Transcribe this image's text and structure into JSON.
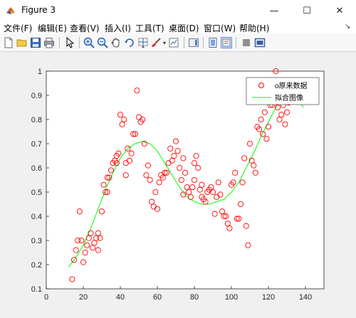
{
  "window": {
    "title": "Figure 3",
    "min_symbol": "—",
    "max_symbol": "☐",
    "close_symbol": "✕"
  },
  "menu": [
    {
      "label": "文件(F)",
      "name": "menu-file"
    },
    {
      "label": "编辑(E)",
      "name": "menu-edit"
    },
    {
      "label": "查看(V)",
      "name": "menu-view"
    },
    {
      "label": "插入(I)",
      "name": "menu-insert"
    },
    {
      "label": "工具(T)",
      "name": "menu-tools"
    },
    {
      "label": "桌面(D)",
      "name": "menu-desktop"
    },
    {
      "label": "窗口(W)",
      "name": "menu-window"
    },
    {
      "label": "帮助(H)",
      "name": "menu-help"
    }
  ],
  "toolbar": [
    "new-figure-icon",
    "open-file-icon",
    "save-icon",
    "print-icon",
    "pointer-icon",
    "zoom-in-icon",
    "zoom-out-icon",
    "pan-icon",
    "rotate-3d-icon",
    "data-cursor-icon",
    "brush-icon",
    "link-plot-icon",
    "insert-colorbar-icon",
    "insert-legend-icon",
    "hide-plot-tools-icon",
    "show-plot-tools-icon"
  ],
  "chart_data": {
    "type": "scatter",
    "xlim": [
      0,
      150
    ],
    "ylim": [
      0.1,
      1.0
    ],
    "xticks": [
      0,
      20,
      40,
      60,
      80,
      100,
      120,
      140
    ],
    "yticks": [
      0.1,
      0.2,
      0.3,
      0.4,
      0.5,
      0.6,
      0.7,
      0.8,
      0.9,
      1
    ],
    "xtick_labels": [
      "0",
      "20",
      "40",
      "60",
      "80",
      "100",
      "120",
      "140"
    ],
    "ytick_labels": [
      "0.1",
      "0.2",
      "0.3",
      "0.4",
      "0.5",
      "0.6",
      "0.7",
      "0.8",
      "0.9",
      "1"
    ],
    "grid": false,
    "legend_position": "top-right",
    "colors": {
      "scatter": "#ff0000",
      "fit": "#00ff00"
    },
    "series": [
      {
        "name": "o原来数据",
        "style": "circle",
        "points": [
          [
            14,
            0.14
          ],
          [
            15,
            0.22
          ],
          [
            16,
            0.26
          ],
          [
            17,
            0.3
          ],
          [
            18,
            0.42
          ],
          [
            19,
            0.3
          ],
          [
            20,
            0.21
          ],
          [
            21,
            0.25
          ],
          [
            22,
            0.28
          ],
          [
            23,
            0.31
          ],
          [
            24,
            0.33
          ],
          [
            25,
            0.27
          ],
          [
            26,
            0.29
          ],
          [
            27,
            0.31
          ],
          [
            28,
            0.26
          ],
          [
            28,
            0.33
          ],
          [
            29,
            0.31
          ],
          [
            30,
            0.42
          ],
          [
            31,
            0.53
          ],
          [
            32,
            0.5
          ],
          [
            33,
            0.5
          ],
          [
            33,
            0.56
          ],
          [
            34,
            0.56
          ],
          [
            35,
            0.59
          ],
          [
            36,
            0.62
          ],
          [
            37,
            0.63
          ],
          [
            38,
            0.62
          ],
          [
            38,
            0.65
          ],
          [
            39,
            0.66
          ],
          [
            40,
            0.82
          ],
          [
            41,
            0.78
          ],
          [
            42,
            0.8
          ],
          [
            43,
            0.57
          ],
          [
            43,
            0.62
          ],
          [
            44,
            0.68
          ],
          [
            45,
            0.63
          ],
          [
            46,
            0.66
          ],
          [
            47,
            0.74
          ],
          [
            48,
            0.74
          ],
          [
            49,
            0.92
          ],
          [
            50,
            0.81
          ],
          [
            51,
            0.79
          ],
          [
            52,
            0.8
          ],
          [
            53,
            0.7
          ],
          [
            54,
            0.57
          ],
          [
            55,
            0.61
          ],
          [
            56,
            0.55
          ],
          [
            57,
            0.46
          ],
          [
            58,
            0.44
          ],
          [
            59,
            0.5
          ],
          [
            60,
            0.43
          ],
          [
            61,
            0.54
          ],
          [
            62,
            0.57
          ],
          [
            63,
            0.56
          ],
          [
            64,
            0.58
          ],
          [
            65,
            0.58
          ],
          [
            66,
            0.62
          ],
          [
            67,
            0.68
          ],
          [
            68,
            0.63
          ],
          [
            69,
            0.65
          ],
          [
            70,
            0.71
          ],
          [
            71,
            0.67
          ],
          [
            72,
            0.6
          ],
          [
            73,
            0.55
          ],
          [
            74,
            0.49
          ],
          [
            74,
            0.64
          ],
          [
            75,
            0.58
          ],
          [
            76,
            0.52
          ],
          [
            77,
            0.5
          ],
          [
            78,
            0.48
          ],
          [
            79,
            0.52
          ],
          [
            80,
            0.55
          ],
          [
            80,
            0.62
          ],
          [
            81,
            0.65
          ],
          [
            82,
            0.6
          ],
          [
            83,
            0.51
          ],
          [
            84,
            0.48
          ],
          [
            84,
            0.53
          ],
          [
            85,
            0.47
          ],
          [
            86,
            0.46
          ],
          [
            87,
            0.5
          ],
          [
            88,
            0.51
          ],
          [
            89,
            0.52
          ],
          [
            90,
            0.5
          ],
          [
            91,
            0.41
          ],
          [
            92,
            0.48
          ],
          [
            93,
            0.54
          ],
          [
            94,
            0.49
          ],
          [
            95,
            0.42
          ],
          [
            96,
            0.4
          ],
          [
            97,
            0.4
          ],
          [
            98,
            0.37
          ],
          [
            99,
            0.35
          ],
          [
            100,
            0.53
          ],
          [
            101,
            0.54
          ],
          [
            102,
            0.58
          ],
          [
            103,
            0.39
          ],
          [
            104,
            0.39
          ],
          [
            105,
            0.45
          ],
          [
            106,
            0.54
          ],
          [
            107,
            0.64
          ],
          [
            108,
            0.36
          ],
          [
            109,
            0.28
          ],
          [
            110,
            0.7
          ],
          [
            111,
            0.63
          ],
          [
            112,
            0.61
          ],
          [
            113,
            0.58
          ],
          [
            114,
            0.77
          ],
          [
            115,
            0.76
          ],
          [
            116,
            0.8
          ],
          [
            117,
            0.74
          ],
          [
            118,
            0.83
          ],
          [
            119,
            0.72
          ],
          [
            120,
            0.77
          ],
          [
            121,
            0.86
          ],
          [
            122,
            0.86
          ],
          [
            123,
            0.88
          ],
          [
            124,
            1.0
          ],
          [
            125,
            0.85
          ],
          [
            126,
            0.8
          ],
          [
            127,
            0.82
          ],
          [
            128,
            0.86
          ],
          [
            129,
            0.78
          ],
          [
            130,
            0.83
          ],
          [
            131,
            0.87
          ]
        ]
      },
      {
        "name": "拟合图像",
        "style": "line",
        "points": [
          [
            12,
            0.19
          ],
          [
            16,
            0.23
          ],
          [
            20,
            0.28
          ],
          [
            24,
            0.35
          ],
          [
            28,
            0.43
          ],
          [
            32,
            0.51
          ],
          [
            36,
            0.58
          ],
          [
            40,
            0.64
          ],
          [
            44,
            0.68
          ],
          [
            48,
            0.7
          ],
          [
            52,
            0.71
          ],
          [
            56,
            0.7
          ],
          [
            60,
            0.67
          ],
          [
            64,
            0.62
          ],
          [
            68,
            0.57
          ],
          [
            72,
            0.52
          ],
          [
            76,
            0.48
          ],
          [
            80,
            0.46
          ],
          [
            84,
            0.45
          ],
          [
            88,
            0.45
          ],
          [
            92,
            0.46
          ],
          [
            96,
            0.47
          ],
          [
            100,
            0.5
          ],
          [
            104,
            0.54
          ],
          [
            108,
            0.6
          ],
          [
            112,
            0.66
          ],
          [
            116,
            0.73
          ],
          [
            120,
            0.79
          ],
          [
            124,
            0.85
          ],
          [
            128,
            0.88
          ],
          [
            132,
            0.89
          ],
          [
            136,
            0.88
          ],
          [
            139,
            0.85
          ]
        ]
      }
    ]
  }
}
